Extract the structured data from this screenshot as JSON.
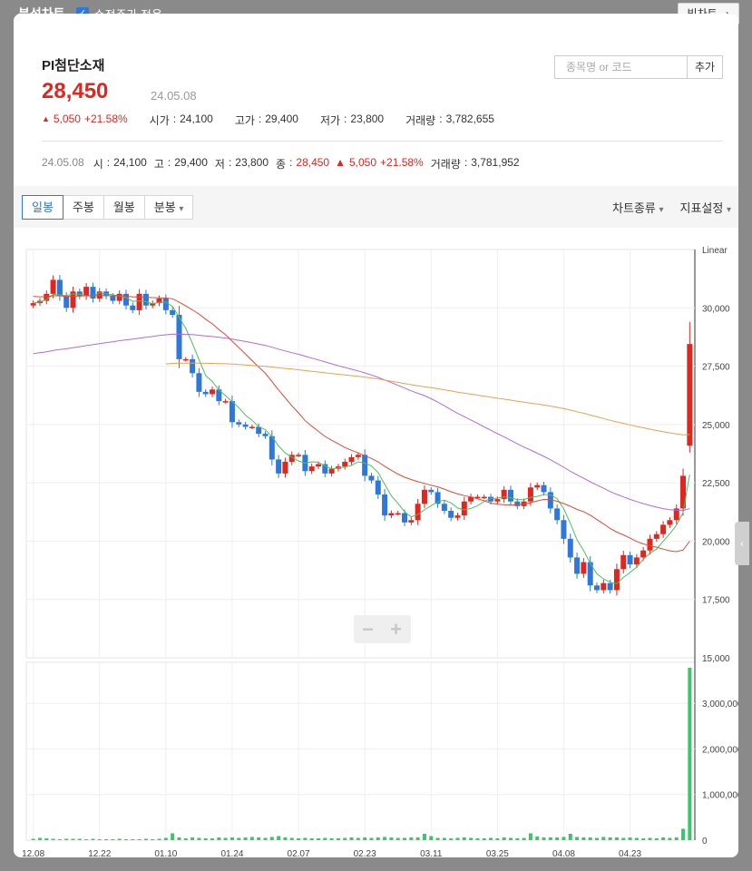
{
  "topbar": {
    "title": "분석차트",
    "check_mark": "✓",
    "adjusted_label": "수정주가 적용",
    "big_chart_label": "빅차트"
  },
  "stock": {
    "name": "PI첨단소재",
    "price": "28,450",
    "date": "24.05.08",
    "change_arrow": "▲",
    "change": "5,050",
    "change_pct": "+21.58%",
    "open_label": "시가",
    "open": "24,100",
    "high_label": "고가",
    "high": "29,400",
    "low_label": "저가",
    "low": "23,800",
    "volume_label": "거래량",
    "volume": "3,782,655"
  },
  "search": {
    "placeholder": "종목명 or 코드",
    "add_label": "추가"
  },
  "bar_info": {
    "date": "24.05.08",
    "o_label": "시",
    "o": "24,100",
    "h_label": "고",
    "h": "29,400",
    "l_label": "저",
    "l": "23,800",
    "c_label": "종",
    "c": "28,450",
    "chg_arrow": "▲",
    "chg": "5,050",
    "chg_pct": "+21.58%",
    "v_label": "거래량",
    "v": "3,781,952"
  },
  "tabs": [
    {
      "label": "일봉",
      "active": true
    },
    {
      "label": "주봉"
    },
    {
      "label": "월봉"
    },
    {
      "label": "분봉"
    }
  ],
  "dropdown_icon": "▾",
  "tool_right": {
    "chart_type": "차트종류",
    "indicator": "지표설정"
  },
  "zoom": {
    "minus": "−",
    "plus": "+"
  },
  "side_handle_icon": "‹",
  "colors": {
    "up": "#e0261f",
    "down": "#2d78d8",
    "ma5": "#4cc15a",
    "ma20": "#e0493a",
    "ma60": "#b16bdc",
    "ma120": "#e7a252",
    "volume": "#3cc56b"
  },
  "chart_data": {
    "type": "candlestick",
    "scale_label": "Linear",
    "y_ticks": [
      "30,000",
      "27,500",
      "25,000",
      "22,500",
      "20,000",
      "17,500",
      "15,000"
    ],
    "y_tick_values": [
      30000,
      27500,
      25000,
      22500,
      20000,
      17500,
      15000
    ],
    "ylim": [
      15000,
      32500
    ],
    "vol_ticks": [
      "3,000,000",
      "2,000,000",
      "1,000,000",
      "0"
    ],
    "vol_tick_values": [
      3000000,
      2000000,
      1000000,
      0
    ],
    "vol_max": 3900000,
    "x_labels": [
      {
        "i": 0,
        "label": "12.08"
      },
      {
        "i": 10,
        "label": "12.22"
      },
      {
        "i": 20,
        "label": "01.10"
      },
      {
        "i": 30,
        "label": "01.24"
      },
      {
        "i": 40,
        "label": "02.07"
      },
      {
        "i": 50,
        "label": "02.23"
      },
      {
        "i": 60,
        "label": "03.11"
      },
      {
        "i": 70,
        "label": "03.25"
      },
      {
        "i": 80,
        "label": "04.08"
      },
      {
        "i": 90,
        "label": "04.23"
      }
    ],
    "closes": [
      30200,
      30300,
      30600,
      31200,
      30500,
      30000,
      30700,
      30500,
      30900,
      30400,
      30700,
      30500,
      30300,
      30600,
      30100,
      29900,
      30600,
      30100,
      30200,
      30400,
      29900,
      29700,
      27800,
      27800,
      27200,
      26400,
      26300,
      26500,
      26000,
      26000,
      25100,
      25000,
      24900,
      24900,
      24600,
      24500,
      23500,
      22900,
      23400,
      23700,
      23700,
      23000,
      23200,
      23300,
      22900,
      23100,
      23200,
      23400,
      23600,
      23700,
      22800,
      22600,
      22000,
      21100,
      21200,
      21200,
      20800,
      20900,
      21600,
      22200,
      22100,
      21600,
      21300,
      21000,
      21100,
      21700,
      21900,
      21900,
      21900,
      21700,
      21800,
      22200,
      21700,
      21500,
      21700,
      22300,
      22400,
      22100,
      21400,
      20900,
      20100,
      19300,
      18600,
      19100,
      18100,
      17900,
      18200,
      17900,
      18800,
      19400,
      19000,
      19300,
      19600,
      20100,
      20300,
      20700,
      20900,
      21400,
      22800,
      28450
    ],
    "volumes": [
      30000,
      50000,
      40000,
      30000,
      20000,
      30000,
      30000,
      30000,
      20000,
      30000,
      20000,
      20000,
      20000,
      30000,
      20000,
      20000,
      20000,
      30000,
      20000,
      30000,
      50000,
      150000,
      60000,
      40000,
      60000,
      50000,
      40000,
      40000,
      60000,
      50000,
      60000,
      50000,
      60000,
      70000,
      60000,
      50000,
      70000,
      90000,
      60000,
      50000,
      40000,
      50000,
      40000,
      40000,
      50000,
      40000,
      40000,
      50000,
      60000,
      50000,
      60000,
      50000,
      60000,
      70000,
      60000,
      50000,
      50000,
      60000,
      60000,
      140000,
      90000,
      50000,
      50000,
      40000,
      50000,
      60000,
      50000,
      40000,
      40000,
      50000,
      40000,
      60000,
      50000,
      40000,
      50000,
      150000,
      80000,
      60000,
      60000,
      60000,
      70000,
      140000,
      70000,
      60000,
      60000,
      50000,
      70000,
      60000,
      60000,
      50000,
      60000,
      50000,
      40000,
      50000,
      40000,
      60000,
      50000,
      60000,
      250000,
      3782655
    ]
  }
}
